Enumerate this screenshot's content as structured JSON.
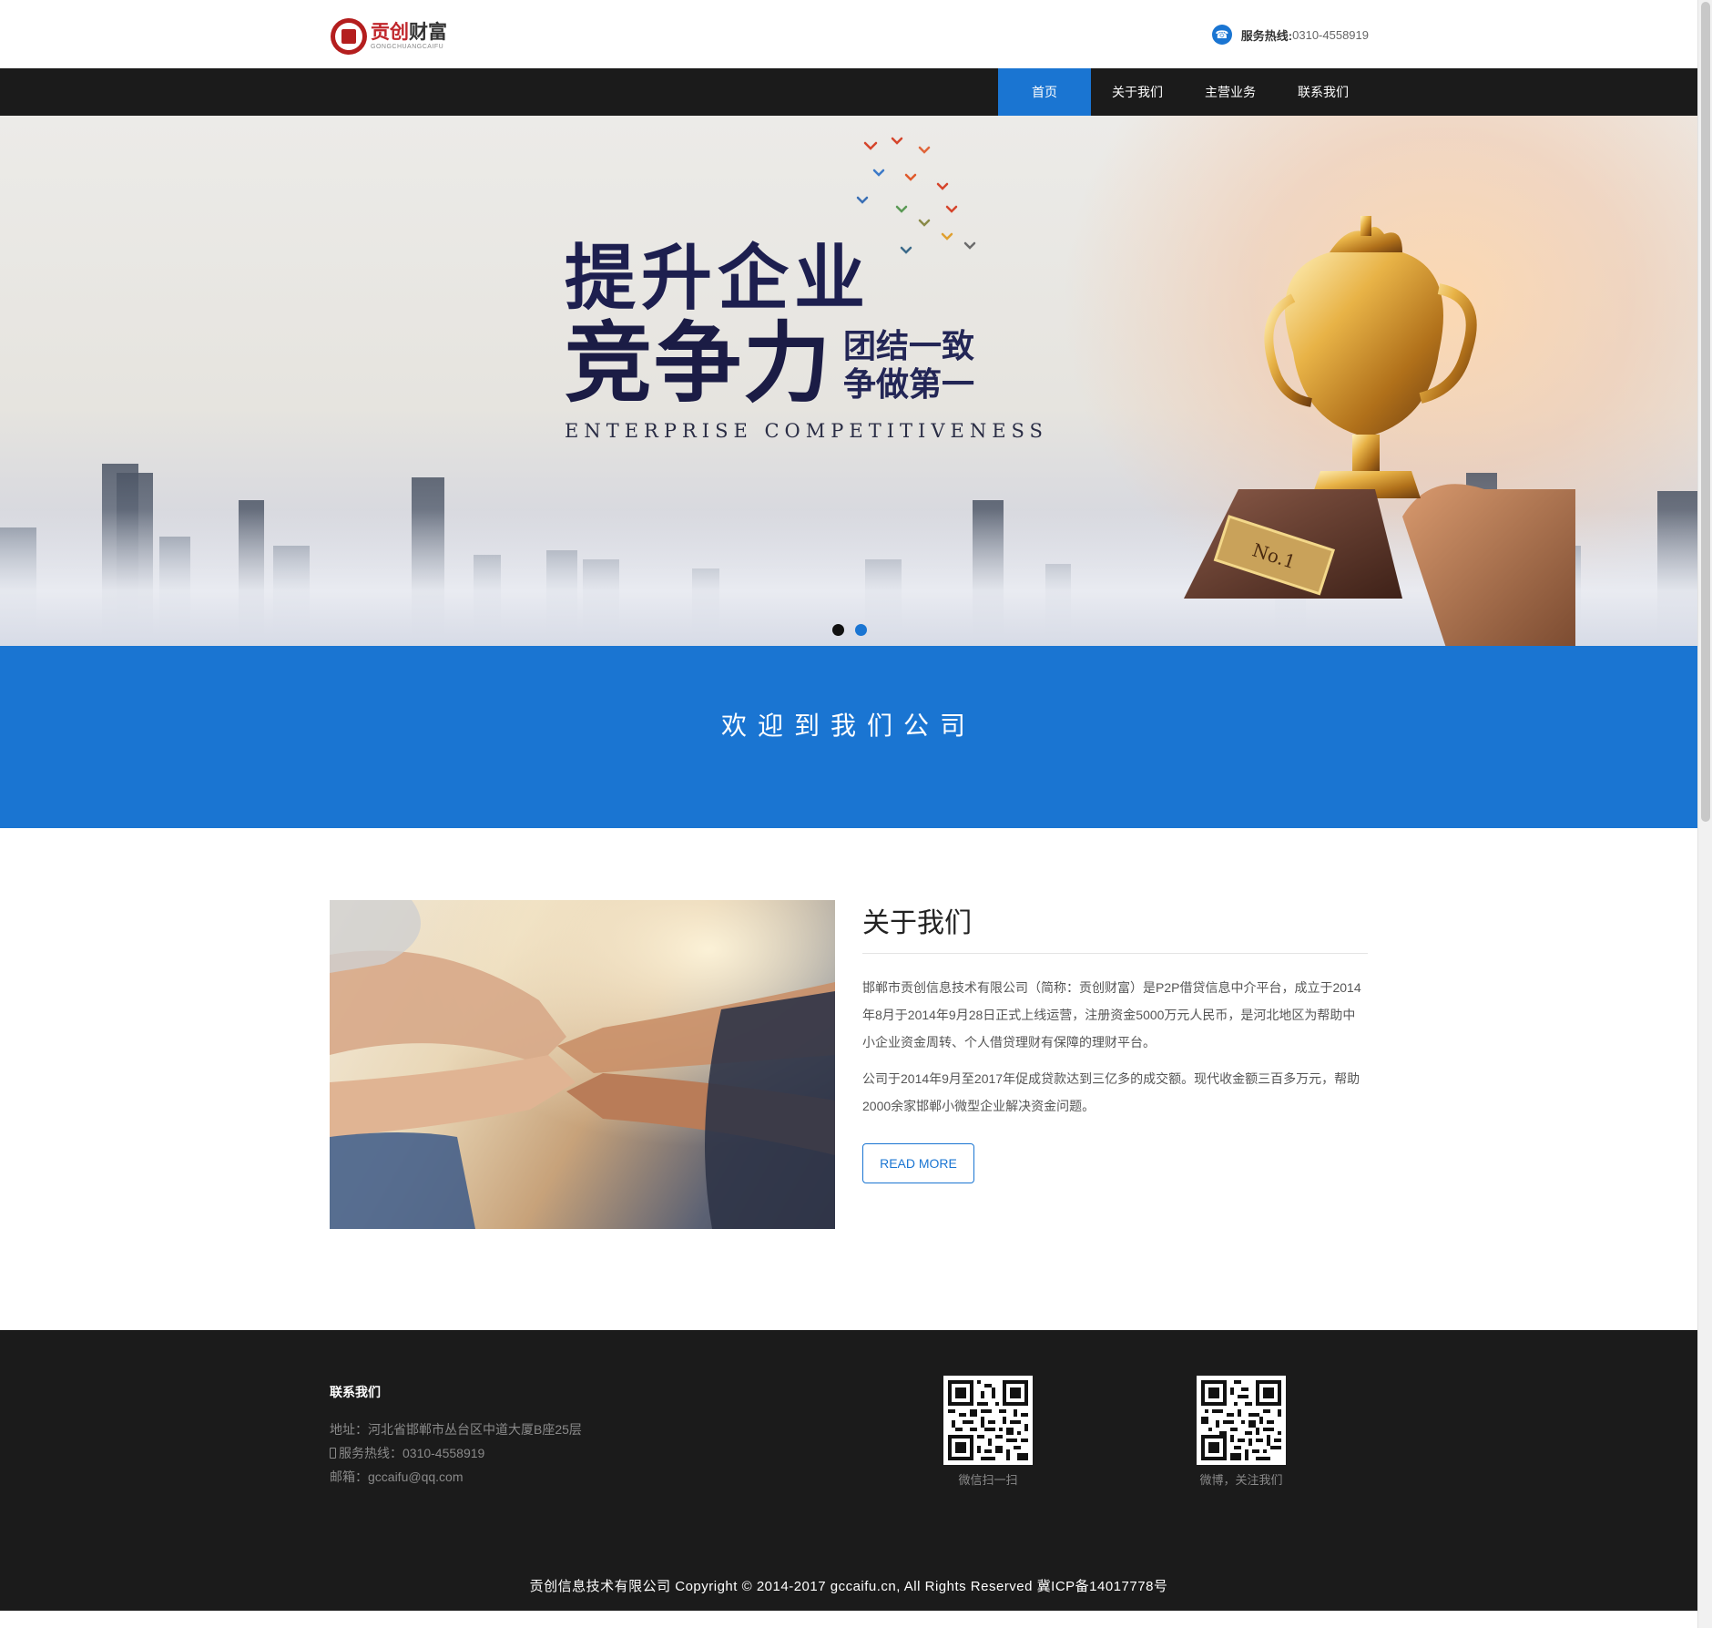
{
  "header": {
    "logo": {
      "name_red": "贡创",
      "name_dark": "财富",
      "sub": "GONGCHUANGCAIFU"
    },
    "hotline": {
      "label": "服务热线:",
      "number": "0310-4558919"
    }
  },
  "nav": {
    "items": [
      "首页",
      "关于我们",
      "主营业务",
      "联系我们"
    ]
  },
  "banner": {
    "line1": "提升企业",
    "line2": "竞争力",
    "line3a": "团结一致",
    "line3b": "争做第一",
    "english": "ENTERPRISE COMPETITIVENESS",
    "trophy_label": "No.1",
    "slides_count": 2,
    "active_slide": 2
  },
  "welcome": {
    "title": "欢迎到我们公司"
  },
  "about": {
    "title": "关于我们",
    "p1": "邯郸市贡创信息技术有限公司（简称：贡创财富）是P2P借贷信息中介平台，成立于2014年8月于2014年9月28日正式上线运营，注册资金5000万元人民币，是河北地区为帮助中小企业资金周转、个人借贷理财有保障的理财平台。",
    "p2": "公司于2014年9月至2017年促成贷款达到三亿多的成交额。现代收金额三百多万元，帮助2000余家邯郸小微型企业解决资金问题。",
    "button": "READ MORE"
  },
  "footer": {
    "contact_title": "联系我们",
    "address": "地址：河北省邯郸市丛台区中道大厦B座25层",
    "phone": "服务热线：0310-4558919",
    "email": "邮箱：gccaifu@qq.com",
    "qr1_caption": "微信扫一扫",
    "qr2_caption": "微博，关注我们",
    "copyright": "贡创信息技术有限公司 Copyright © 2014-2017 gccaifu.cn, All Rights Reserved 冀ICP备14017778号"
  },
  "colors": {
    "accent": "#1a75d2",
    "nav_bg": "#1b1b1b",
    "footer_bg": "#1b1b1b",
    "logo_red": "#c0262b"
  }
}
